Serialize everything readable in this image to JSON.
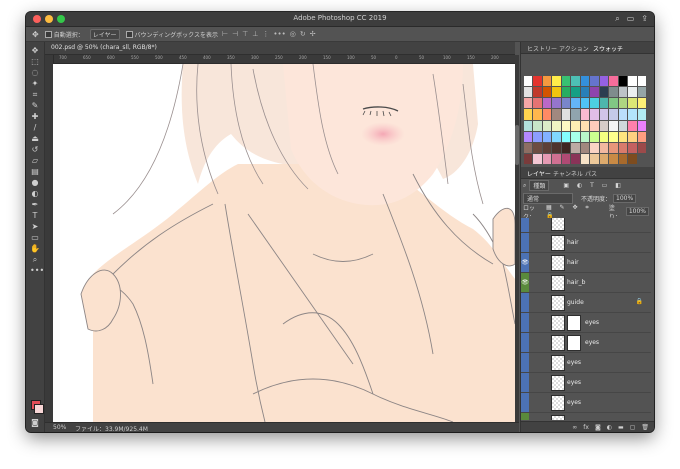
{
  "app": {
    "title": "Adobe Photoshop CC 2019"
  },
  "options_bar": {
    "move_tool_icon": "move-icon",
    "auto_select_label": "自動選択：",
    "auto_select_value": "レイヤー",
    "bounding_box_label": "バウンディングボックスを表示"
  },
  "document": {
    "tab_label": "002.psd @ 50% (chara_sll, RGB/8*)",
    "zoom": "50%",
    "file_info": "ファイル：33.9M/925.4M",
    "ruler_ticks": [
      "700",
      "650",
      "600",
      "550",
      "500",
      "450",
      "400",
      "350",
      "300",
      "250",
      "200",
      "150",
      "100",
      "50",
      "0",
      "50",
      "100",
      "150",
      "200"
    ]
  },
  "panels": {
    "top_tabs": [
      "ヒストリー",
      "アクション",
      "スウォッチ"
    ],
    "active_top_tab": "スウォッチ",
    "layer_tabs": [
      "レイヤー",
      "チャンネル",
      "パス"
    ],
    "filter_label": "種類",
    "blend_mode": "通常",
    "opacity_label": "不透明度：",
    "opacity_value": "100%",
    "lock_label": "ロック：",
    "fill_label": "塗り：",
    "fill_value": "100%",
    "swatch_colors": [
      "#ffffff",
      "#e3342f",
      "#f6993f",
      "#ffed4a",
      "#38c172",
      "#4dc0b5",
      "#3490dc",
      "#6574cd",
      "#9561e2",
      "#f66d9b",
      "#000000",
      "#ffffff",
      "#ffffff",
      "#e2e2e2",
      "#c0392b",
      "#d35400",
      "#f1c40f",
      "#27ae60",
      "#16a085",
      "#2980b9",
      "#8e44ad",
      "#2c3e50",
      "#7f8c8d",
      "#bdc3c7",
      "#ecf0f1",
      "#95a5a6",
      "#f4a6a6",
      "#e57373",
      "#ba68c8",
      "#9575cd",
      "#7986cb",
      "#64b5f6",
      "#4fc3f7",
      "#4dd0e1",
      "#4db6ac",
      "#81c784",
      "#aed581",
      "#dce775",
      "#fff176",
      "#ffd54f",
      "#ffb74d",
      "#ff8a65",
      "#a1887f",
      "#e0e0e0",
      "#90a4ae",
      "#f8bbd0",
      "#e1bee7",
      "#d1c4e9",
      "#c5cae9",
      "#bbdefb",
      "#b3e5fc",
      "#b2ebf2",
      "#b2dfdb",
      "#c8e6c9",
      "#dcedc8",
      "#f0f4c3",
      "#fff9c4",
      "#ffecb3",
      "#ffe0b2",
      "#ffccbc",
      "#d7ccc8",
      "#f5f5f5",
      "#cfd8dc",
      "#ff80ab",
      "#ea80fc",
      "#b388ff",
      "#8c9eff",
      "#82b1ff",
      "#80d8ff",
      "#84ffff",
      "#a7ffeb",
      "#b9f6ca",
      "#ccff90",
      "#f4ff81",
      "#ffff8d",
      "#ffe57f",
      "#ffd180",
      "#ff9e80",
      "#8d6e63",
      "#6d4c41",
      "#5d4037",
      "#4e342e",
      "#3e2723",
      "#bcaaa4",
      "#a1887f",
      "#f9d3c4",
      "#f2b8a0",
      "#e8967a",
      "#d97b6c",
      "#c46060",
      "#9c4a4a",
      "#7a3b3b",
      "#f3c6d3",
      "#e59ab3",
      "#d07092",
      "#b04a74",
      "#8a3358",
      "#f7e3c8",
      "#ecc89a",
      "#ddaa6d",
      "#c98a45",
      "#a86a2c",
      "#7d4c1f"
    ],
    "layers": [
      {
        "name": "",
        "visible": false,
        "thumb": "checker",
        "indent": 0
      },
      {
        "name": "hair",
        "visible": false,
        "thumb": "checker",
        "indent": 0
      },
      {
        "name": "hair",
        "visible": true,
        "thumb": "checker",
        "indent": 0
      },
      {
        "name": "hair_b",
        "visible": true,
        "thumb": "checker",
        "indent": 0
      },
      {
        "name": "guide",
        "visible": false,
        "thumb": "checker",
        "indent": 0,
        "locked": true
      },
      {
        "name": "eyes",
        "visible": false,
        "thumb": "white",
        "indent": 1
      },
      {
        "name": "eyes",
        "visible": false,
        "thumb": "white",
        "indent": 1
      },
      {
        "name": "eyes",
        "visible": false,
        "thumb": "checker",
        "indent": 0
      },
      {
        "name": "eyes",
        "visible": false,
        "thumb": "checker",
        "indent": 0
      },
      {
        "name": "eyes",
        "visible": false,
        "thumb": "checker",
        "indent": 0
      },
      {
        "name": "eyes",
        "visible": false,
        "thumb": "checker",
        "indent": 0
      }
    ],
    "footer_icons": [
      "link-icon",
      "fx-icon",
      "mask-icon",
      "adjustment-icon",
      "folder-icon",
      "new-layer-icon",
      "trash-icon"
    ]
  },
  "tools": [
    "move-icon",
    "marquee-icon",
    "lasso-icon",
    "magic-wand-icon",
    "crop-icon",
    "eyedropper-icon",
    "healing-icon",
    "brush-icon",
    "stamp-icon",
    "history-brush-icon",
    "eraser-icon",
    "gradient-icon",
    "blur-icon",
    "dodge-icon",
    "pen-icon",
    "type-icon",
    "path-select-icon",
    "shape-icon",
    "hand-icon",
    "zoom-icon",
    "more-icon"
  ]
}
